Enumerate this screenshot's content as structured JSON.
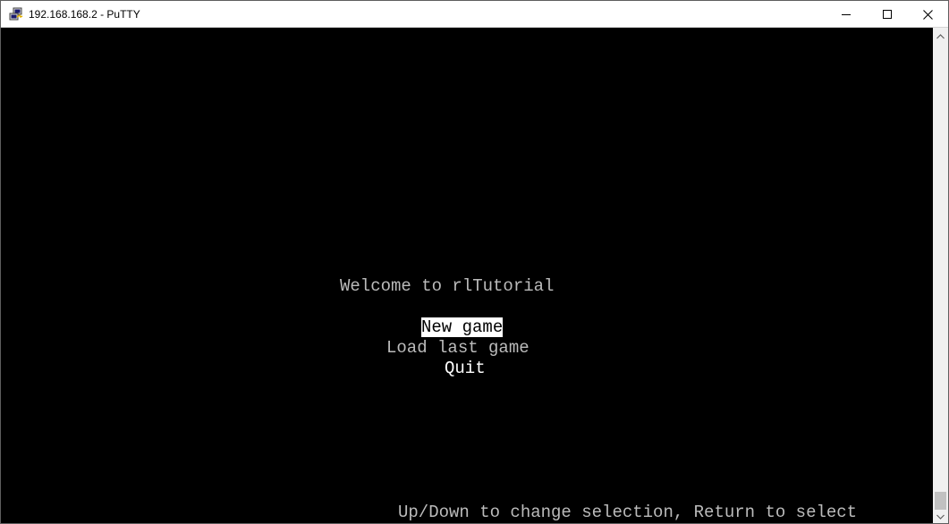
{
  "window": {
    "title": "192.168.168.2 - PuTTY",
    "icon": "putty-icon",
    "controls": {
      "minimize": "minimize-icon",
      "maximize": "maximize-icon",
      "close": "close-icon"
    }
  },
  "terminal": {
    "welcome": "Welcome to rlTutorial",
    "menu": [
      {
        "label": "New game",
        "selected": true
      },
      {
        "label": "Load last game",
        "selected": false
      },
      {
        "label": "Quit",
        "selected": false
      }
    ],
    "status": "Up/Down to change selection, Return to select"
  },
  "scrollbar": {
    "up_icon": "scroll-up-arrow-icon",
    "down_icon": "scroll-down-arrow-icon"
  },
  "colors": {
    "terminal_bg": "#000000",
    "terminal_fg": "#bbbbbb",
    "bold_fg": "#ffffff",
    "selection_bg": "#ffffff",
    "selection_fg": "#000000"
  }
}
